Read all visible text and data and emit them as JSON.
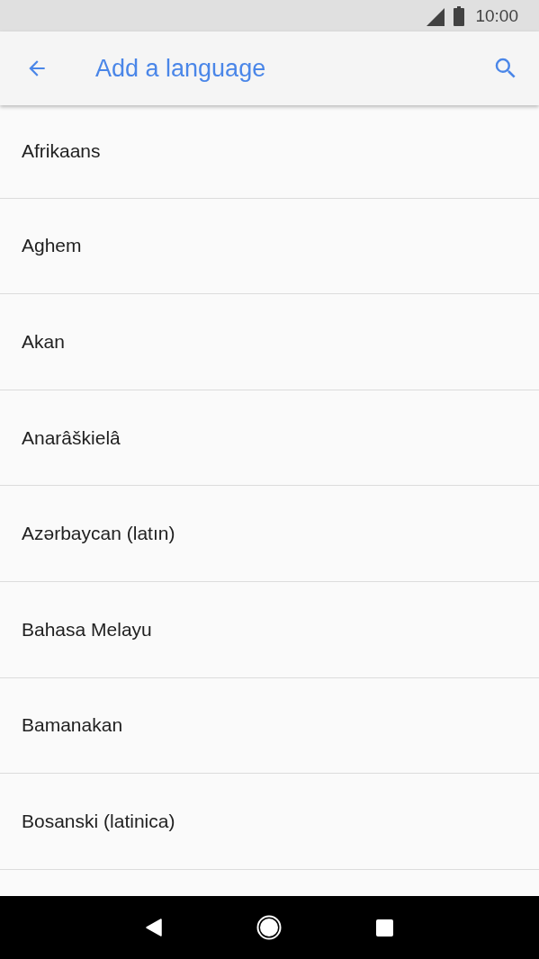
{
  "status_bar": {
    "time": "10:00"
  },
  "app_bar": {
    "title": "Add a language"
  },
  "languages": [
    {
      "name": "Afrikaans"
    },
    {
      "name": "Aghem"
    },
    {
      "name": "Akan"
    },
    {
      "name": "Anarâškielâ"
    },
    {
      "name": "Azərbaycan (latın)"
    },
    {
      "name": "Bahasa Melayu"
    },
    {
      "name": "Bamanakan"
    },
    {
      "name": "Bosanski (latinica)"
    }
  ]
}
